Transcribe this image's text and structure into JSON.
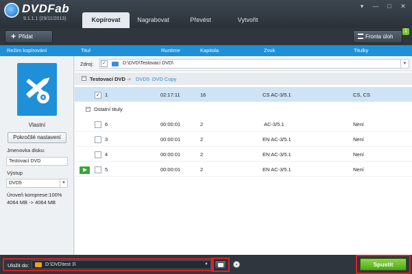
{
  "app": {
    "brand": "DVDFab",
    "version": "9.1.1.1 (29/11/2013)"
  },
  "tabs": [
    {
      "label": "Kopírovat",
      "active": true
    },
    {
      "label": "Nagrabovat",
      "active": false
    },
    {
      "label": "Převést",
      "active": false
    },
    {
      "label": "Vytvořit",
      "active": false
    }
  ],
  "window_controls": {
    "settings": "▾",
    "minimize": "—",
    "maximize": "□",
    "close": "✕"
  },
  "toolbar": {
    "add_label": "Přidat",
    "add_icon": "+",
    "queue_label": "Fronta úloh",
    "queue_badge": "1"
  },
  "columns": {
    "mode": "Režim kopírování",
    "title": "Titul",
    "runtime": "Runtime",
    "chapter": "Kapitola",
    "audio": "Zvuk",
    "subtitles": "Titulky"
  },
  "left": {
    "mode_label": "Vlastní",
    "advanced_button": "Pokročilé nastavení",
    "disc_label_caption": "Jmenovka disku:",
    "disc_label_value": "Testovací DVD",
    "output_caption": "Výstup",
    "output_value": "DVD5",
    "compression_caption": "Úroveň komprese:100%",
    "compression_sizes": "4064 MB -> 4064 MB"
  },
  "source": {
    "label": "Zdroj:",
    "path": "D:\\DVD\\Testovací DVD\\",
    "checked": "✓"
  },
  "title_row": {
    "name": "Testovací DVD",
    "target": "DVD5",
    "mode": "DVD Copy",
    "collapse": "–",
    "arrow": "➔"
  },
  "main_title": {
    "checked": "✓",
    "title": "1",
    "runtime": "02:17:11",
    "chapter": "16",
    "audio": "CS AC-3/5.1",
    "subtitles": "CS, CS"
  },
  "other_titles": {
    "label": "Ostatní tituly",
    "collapse": "–"
  },
  "other_rows": [
    {
      "title": "6",
      "runtime": "00:00:01",
      "chapter": "2",
      "audio": "AC-3/5.1",
      "subtitles": "Není"
    },
    {
      "title": "3",
      "runtime": "00:00:01",
      "chapter": "2",
      "audio": "EN AC-3/5.1",
      "subtitles": "Není"
    },
    {
      "title": "4",
      "runtime": "00:00:01",
      "chapter": "2",
      "audio": "EN AC-3/5.1",
      "subtitles": "Není"
    },
    {
      "title": "5",
      "runtime": "00:00:01",
      "chapter": "2",
      "audio": "EN AC-3/5.1",
      "subtitles": "Není"
    }
  ],
  "bottom": {
    "save_label": "Uložit do:",
    "save_path": "D:\\DVD\\test 3\\",
    "dropdown": "▼",
    "start_label": "Spustit"
  },
  "colors": {
    "accent": "#1f8fd8",
    "start_green": "#5cb325",
    "highlight_red": "#e02020",
    "dark_bar": "#2f363e"
  }
}
